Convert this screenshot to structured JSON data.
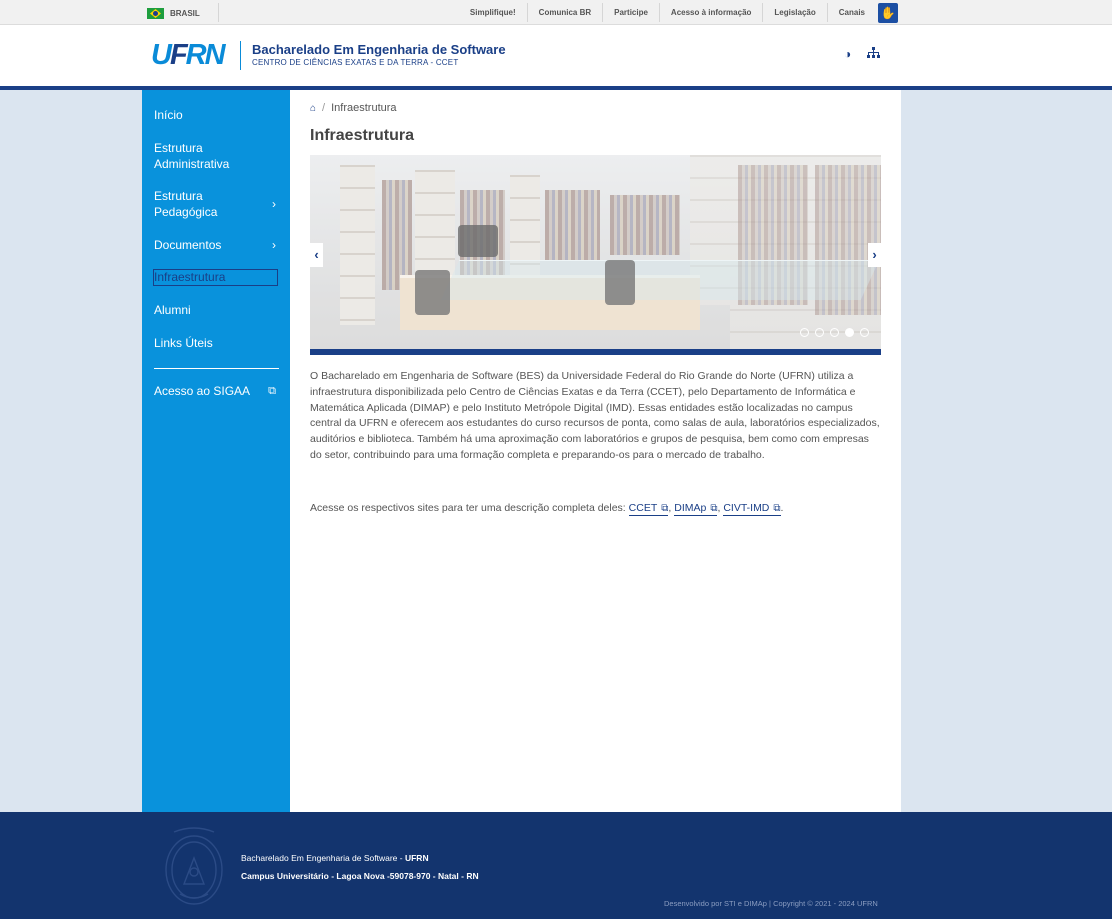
{
  "gov_bar": {
    "country": "BRASIL",
    "links": [
      "Simplifique!",
      "Comunica BR",
      "Participe",
      "Acesso à informação",
      "Legislação",
      "Canais"
    ],
    "accessibility_icon": "hand-sign-icon"
  },
  "header": {
    "logo_text": {
      "u": "U",
      "f": "F",
      "rn": "RN"
    },
    "title": "Bacharelado Em Engenharia de Software",
    "subtitle": "CENTRO DE CIÊNCIAS EXATAS E DA TERRA - CCET",
    "tools": [
      "contrast-icon",
      "sitemap-icon"
    ]
  },
  "sidebar": {
    "items": [
      {
        "label": "Início"
      },
      {
        "label": "Estrutura Administrativa"
      },
      {
        "label": "Estrutura Pedagógica"
      },
      {
        "label": "Documentos"
      },
      {
        "label": "Infraestrutura"
      },
      {
        "label": "Alumni"
      },
      {
        "label": "Links Úteis"
      }
    ],
    "sigaa_label": "Acesso ao SIGAA"
  },
  "breadcrumb": {
    "current": "Infraestrutura"
  },
  "page": {
    "title": "Infraestrutura",
    "paragraph": "O Bacharelado em  Engenharia de Software (BES) da Universidade Federal do Rio Grande do Norte (UFRN) utiliza a infraestrutura disponibilizada pelo Centro de Ciências Exatas e da Terra (CCET), pelo Departamento de Informática e Matemática Aplicada (DIMAP) e pelo Instituto Metrópole Digital (IMD). Essas entidades estão localizadas no campus central da UFRN e oferecem aos estudantes do curso recursos de ponta, como salas de aula, laboratórios especializados, auditórios e biblioteca. Também há uma aproximação com laboratórios e grupos de pesquisa, bem como com empresas do setor, contribuindo para uma formação completa e preparando-os para o mercado de trabalho.",
    "links_intro": "Acesse os respectivos sites para ter uma descrição completa deles:",
    "links": [
      "CCET",
      "DIMAp",
      "CIVT-IMD"
    ],
    "sep_comma": ",",
    "end_period": "."
  },
  "carousel": {
    "slide_count": 5,
    "active_index": 3
  },
  "footer": {
    "line1_prefix": "Bacharelado Em Engenharia de Software - ",
    "line1_bold": "UFRN",
    "line2": "Campus Universitário - Lagoa Nova -59078-970 - Natal - RN",
    "copyright": "Desenvolvido por STI e DIMAp | Copyright © 2021 - 2024 UFRN"
  },
  "colors": {
    "primary": "#1a3f87",
    "sidebar": "#0992dc",
    "footer": "#13346e",
    "page_bg": "#dbe5f0"
  }
}
